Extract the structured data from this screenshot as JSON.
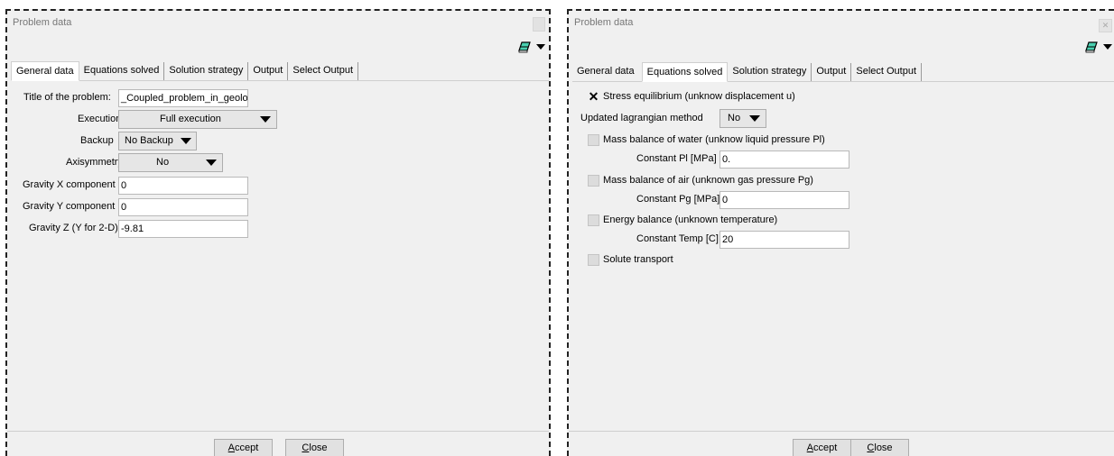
{
  "left": {
    "title": "Problem data",
    "tabs": [
      "General data",
      "Equations solved",
      "Solution strategy",
      "Output",
      "Select Output"
    ],
    "fields": {
      "title_label": "Title of the problem:",
      "title_value": "_Coupled_problem_in_geolo",
      "execution_label": "Execution",
      "execution_value": "Full execution",
      "backup_label": "Backup",
      "backup_value": "No Backup",
      "axisymmetry_label": "Axisymmetry",
      "axisymmetry_value": "No",
      "gx_label": "Gravity X component",
      "gx_value": "0",
      "gy_label": "Gravity Y component",
      "gy_value": "0",
      "gz_label": "Gravity Z (Y for 2-D)",
      "gz_value": "-9.81"
    },
    "accept_a": "A",
    "accept_rest": "ccept",
    "close_c": "C",
    "close_rest": "lose"
  },
  "right": {
    "title": "Problem data",
    "tabs": [
      "General data",
      "Equations solved",
      "Solution strategy",
      "Output",
      "Select Output"
    ],
    "eq": {
      "stress_label": "Stress equilibrium (unknow displacement u)",
      "stress_checked": true,
      "updated_label": "Updated lagrangian method",
      "updated_value": "No",
      "water_label": "Mass balance of water (unknow liquid pressure Pl)",
      "const_pl_label": "Constant Pl [MPa]",
      "const_pl_value": "0.",
      "air_label": "Mass balance of air (unknown  gas pressure Pg)",
      "const_pg_label": "Constant Pg [MPa]",
      "const_pg_value": "0",
      "energy_label": "Energy balance (unknown temperature)",
      "const_temp_label": "Constant Temp [C]",
      "const_temp_value": "20",
      "solute_label": "Solute transport"
    },
    "accept_a": "A",
    "accept_rest": "ccept",
    "close_c": "C",
    "close_rest": "lose"
  },
  "icons": {
    "close": "close-icon",
    "toolbar": "eraser-icon",
    "menu": "caret-down-icon",
    "check": "x-check-icon"
  }
}
